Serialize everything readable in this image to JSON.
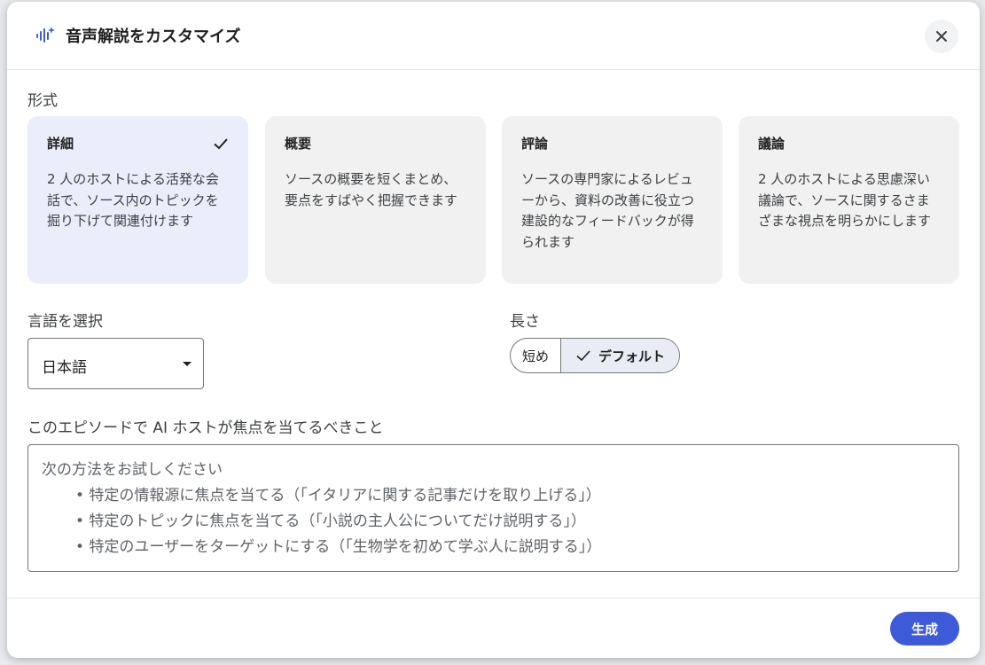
{
  "dialog": {
    "title": "音声解説をカスタマイズ",
    "icon": "audio-sparkle-icon",
    "close_icon": "close-icon"
  },
  "format": {
    "label": "形式",
    "cards": [
      {
        "title": "詳細",
        "description": "2 人のホストによる活発な会話で、ソース内のトピックを掘り下げて関連付けます",
        "selected": true
      },
      {
        "title": "概要",
        "description": "ソースの概要を短くまとめ、要点をすばやく把握できます",
        "selected": false
      },
      {
        "title": "評論",
        "description": "ソースの専門家によるレビューから、資料の改善に役立つ建設的なフィードバックが得られます",
        "selected": false
      },
      {
        "title": "議論",
        "description": "2 人のホストによる思慮深い議論で、ソースに関するさまざまな視点を明らかにします",
        "selected": false
      }
    ]
  },
  "language": {
    "label": "言語を選択",
    "selected": "日本語"
  },
  "length": {
    "label": "長さ",
    "options": [
      {
        "label": "短め",
        "selected": false
      },
      {
        "label": "デフォルト",
        "selected": true
      }
    ]
  },
  "focus": {
    "label": "このエピソードで AI ホストが焦点を当てるべきこと",
    "placeholder_intro": "次の方法をお試しください",
    "placeholder_items": [
      "• 特定の情報源に焦点を当てる（「イタリアに関する記事だけを取り上げる」）",
      "• 特定のトピックに焦点を当てる（「小説の主人公についてだけ説明する」）",
      "• 特定のユーザーをターゲットにする（「生物学を初めて学ぶ人に説明する」）"
    ]
  },
  "footer": {
    "generate_label": "生成"
  },
  "colors": {
    "accent": "#3d5ad8",
    "selected_card": "#eaeefa",
    "card": "#f1f1f1"
  }
}
